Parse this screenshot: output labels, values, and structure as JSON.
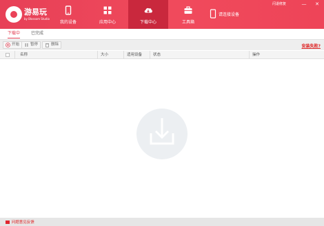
{
  "app": {
    "brand": "游易玩",
    "brand_sub": "by Blossom Studio"
  },
  "nav": {
    "items": [
      {
        "label": "我的设备",
        "icon": "phone-icon"
      },
      {
        "label": "应用中心",
        "icon": "grid-icon"
      },
      {
        "label": "下载中心",
        "icon": "cloud-download-icon",
        "active": true
      },
      {
        "label": "工具箱",
        "icon": "toolbox-icon"
      }
    ],
    "connect_label": "请连接设备"
  },
  "window": {
    "feedback": "闪退修复",
    "minimize": "—",
    "close": "✕"
  },
  "tabs": [
    {
      "label": "下载中",
      "active": true
    },
    {
      "label": "已完成",
      "active": false
    }
  ],
  "toolbar": {
    "start": "开始",
    "pause": "暂停",
    "delete": "删除",
    "install_fail": "安装失败?"
  },
  "table": {
    "columns": [
      "名称",
      "大小",
      "适用设备",
      "状态",
      "操作"
    ]
  },
  "footer": {
    "feedback": "问题意见反馈"
  },
  "colors": {
    "accent": "#ee4458",
    "active_nav": "#c9283d",
    "warning": "#dd2222"
  }
}
